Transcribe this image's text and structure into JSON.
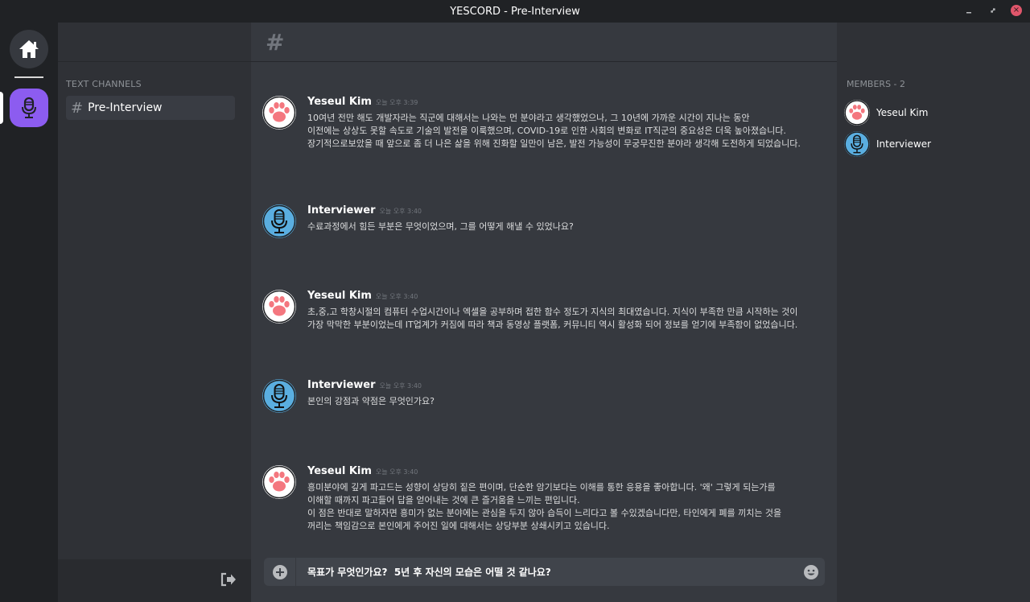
{
  "window": {
    "title": "YESCORD - Pre-Interview",
    "close_glyph": "×"
  },
  "sidebar": {
    "section_label": "TEXT CHANNELS",
    "channels": [
      {
        "name": "Pre-Interview",
        "icon": "hash-icon"
      }
    ]
  },
  "channel_header": {
    "hash": "#"
  },
  "messages": [
    {
      "author": "Yeseul Kim",
      "time": "오늘 오후 3:39",
      "avatar": "paw-avatar",
      "text": "10여년 전만 해도 개발자라는 직군에 대해서는 나와는 먼 분야라고 생각했었으나, 그 10년에 가까운 시간이 지나는 동안\n이전에는 상상도 못할 속도로 기술의 발전을 이룩했으며, COVID-19로 인한 사회의 변화로 IT직군의 중요성은 더욱 높아졌습니다.\n장기적으로보았을 때 앞으로 좀 더 나은 삶을 위해 진화할 일만이 남은, 발전 가능성이 무궁무진한 분야라 생각해 도전하게 되었습니다."
    },
    {
      "author": "Interviewer",
      "time": "오늘 오후 3:40",
      "avatar": "microphone-avatar",
      "text": "수료과정에서 힘든 부분은 무엇이었으며, 그를 어떻게 해낼 수 있었나요?"
    },
    {
      "author": "Yeseul Kim",
      "time": "오늘 오후 3:40",
      "avatar": "paw-avatar",
      "text": "초,중,고 학창시절의 컴퓨터 수업시간이나 엑셀을 공부하며 접한 함수 정도가 지식의 최대였습니다. 지식이 부족한 만큼 시작하는 것이\n가장 막막한 부분이었는데 IT업계가 커짐에 따라 책과 동영상 플랫폼, 커뮤니티 역시 활성화 되어 정보를 얻기에 부족함이 없었습니다."
    },
    {
      "author": "Interviewer",
      "time": "오늘 오후 3:40",
      "avatar": "microphone-avatar",
      "text": "본인의 강점과 약점은 무엇인가요?"
    },
    {
      "author": "Yeseul Kim",
      "time": "오늘 오후 3:40",
      "avatar": "paw-avatar",
      "text": "흥미분야에 깊게 파고드는 성향이 상당히 짙은 편이며, 단순한 암기보다는 이해를 통한 응용을 좋아합니다. '왜' 그렇게 되는가를\n이해할 때까지 파고들어 답을 얻어내는 것에 큰 즐거움을 느끼는 편입니다.\n이 점은 반대로 말하자면 흥미가 없는 분야에는 관심을 두지 않아 습득이 느리다고 볼 수있겠습니다만, 타인에게 폐를 끼치는 것을\n꺼리는 책임감으로 본인에게 주어진 일에 대해서는 상당부분 상쇄시키고 있습니다."
    }
  ],
  "composer": {
    "value": "목표가 무엇인가요?  5년 후 자신의 모습은 어떨 것 같나요?",
    "plus_icon": "plus-circle-icon",
    "emoji_icon": "smiley-icon"
  },
  "members": {
    "label": "MEMBERS - 2",
    "list": [
      {
        "name": "Yeseul Kim",
        "avatar": "paw-avatar"
      },
      {
        "name": "Interviewer",
        "avatar": "microphone-avatar"
      }
    ]
  },
  "colors": {
    "accent_server": "#8c5cf0",
    "interviewer_avatar_bg": "#5aaee0",
    "paw_pink": "#f4777f",
    "close_red": "#e0566b"
  }
}
